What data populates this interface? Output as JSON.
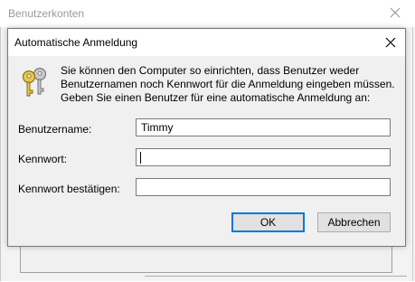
{
  "background_window": {
    "title": "Benutzerkonten"
  },
  "dialog": {
    "title": "Automatische Anmeldung",
    "message_lines": [
      "Sie können den Computer so einrichten, dass Benutzer weder",
      "Benutzernamen noch Kennwort für die Anmeldung eingeben müssen.",
      "Geben Sie einen Benutzer für eine automatische Anmeldung an:"
    ],
    "icon": "keys-icon",
    "fields": {
      "username": {
        "label": "Benutzername:",
        "value": "Timmy"
      },
      "password": {
        "label": "Kennwort:",
        "value": ""
      },
      "confirm": {
        "label": "Kennwort bestätigen:",
        "value": ""
      }
    },
    "buttons": {
      "ok": "OK",
      "cancel": "Abbrechen"
    }
  },
  "colors": {
    "accent": "#0078d7",
    "dialog_bg": "#f0f0f0",
    "titlebar_bg": "#ffffff",
    "inactive_title": "#9a9a9a"
  }
}
